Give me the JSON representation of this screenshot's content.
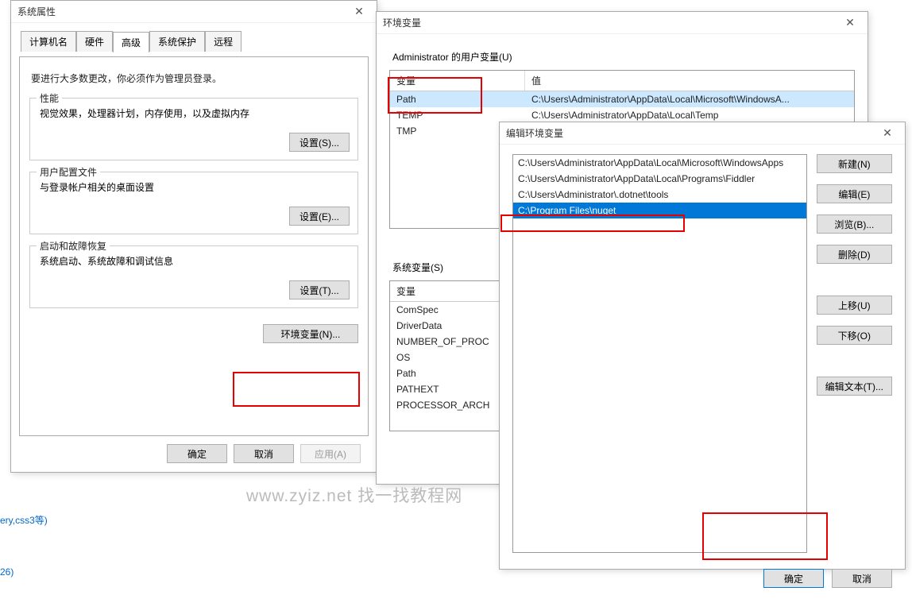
{
  "sysprops": {
    "title": "系统属性",
    "tabs": [
      "计算机名",
      "硬件",
      "高级",
      "系统保护",
      "远程"
    ],
    "active_tab": 2,
    "hint": "要进行大多数更改，你必须作为管理员登录。",
    "groups": {
      "perf": {
        "title": "性能",
        "desc": "视觉效果，处理器计划，内存使用，以及虚拟内存",
        "btn": "设置(S)..."
      },
      "profile": {
        "title": "用户配置文件",
        "desc": "与登录帐户相关的桌面设置",
        "btn": "设置(E)..."
      },
      "startup": {
        "title": "启动和故障恢复",
        "desc": "系统启动、系统故障和调试信息",
        "btn": "设置(T)..."
      }
    },
    "envvars_btn": "环境变量(N)...",
    "buttons": {
      "ok": "确定",
      "cancel": "取消",
      "apply": "应用(A)"
    }
  },
  "envvars": {
    "title": "环境变量",
    "user_label": "Administrator 的用户变量(U)",
    "sys_label": "系统变量(S)",
    "headers": {
      "var": "变量",
      "val": "值"
    },
    "user_vars": [
      {
        "name": "Path",
        "value": "C:\\Users\\Administrator\\AppData\\Local\\Microsoft\\WindowsA..."
      },
      {
        "name": "TEMP",
        "value": "C:\\Users\\Administrator\\AppData\\Local\\Temp"
      },
      {
        "name": "TMP",
        "value": ""
      }
    ],
    "sys_vars": [
      {
        "name": "ComSpec",
        "value": ""
      },
      {
        "name": "DriverData",
        "value": ""
      },
      {
        "name": "NUMBER_OF_PROC",
        "value": ""
      },
      {
        "name": "OS",
        "value": ""
      },
      {
        "name": "Path",
        "value": ""
      },
      {
        "name": "PATHEXT",
        "value": ""
      },
      {
        "name": "PROCESSOR_ARCH",
        "value": ""
      }
    ]
  },
  "editenv": {
    "title": "编辑环境变量",
    "paths": [
      "C:\\Users\\Administrator\\AppData\\Local\\Microsoft\\WindowsApps",
      "C:\\Users\\Administrator\\AppData\\Local\\Programs\\Fiddler",
      "C:\\Users\\Administrator\\.dotnet\\tools",
      "C:\\Program Files\\nuget"
    ],
    "selected": 3,
    "side": {
      "new": "新建(N)",
      "edit": "编辑(E)",
      "browse": "浏览(B)...",
      "delete": "删除(D)",
      "up": "上移(U)",
      "down": "下移(O)",
      "edittext": "编辑文本(T)..."
    },
    "buttons": {
      "ok": "确定",
      "cancel": "取消"
    }
  },
  "watermark": "www.zyiz.net 找一找教程网",
  "linktext1": "ery,css3等)",
  "linktext2": "26)"
}
